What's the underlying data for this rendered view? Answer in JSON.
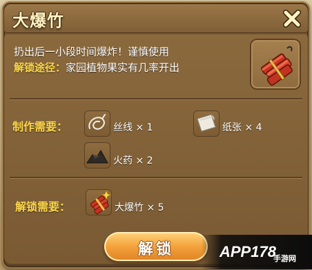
{
  "dialog": {
    "title": "大爆竹",
    "description": "扔出后一小段时间爆炸！谨慎使用",
    "unlock_path_label": "解锁途径：",
    "unlock_path_value": "家园植物果实有几率开出"
  },
  "crafting": {
    "label": "制作需要：",
    "materials": [
      {
        "name": "丝线",
        "qty": "× 1",
        "icon": "thread-icon"
      },
      {
        "name": "纸张",
        "qty": "× 4",
        "icon": "paper-icon"
      },
      {
        "name": "火药",
        "qty": "× 2",
        "icon": "gunpowder-icon"
      }
    ]
  },
  "unlock": {
    "label": "解锁需要：",
    "item_name": "大爆竹",
    "item_qty": "× 5",
    "button_label": "解锁"
  },
  "watermark": {
    "text": "APP178",
    "sub": "手游网"
  },
  "colors": {
    "label_yellow": "#ffd84a",
    "title_text": "#fff3c2",
    "button_orange": "#f3a23c"
  }
}
